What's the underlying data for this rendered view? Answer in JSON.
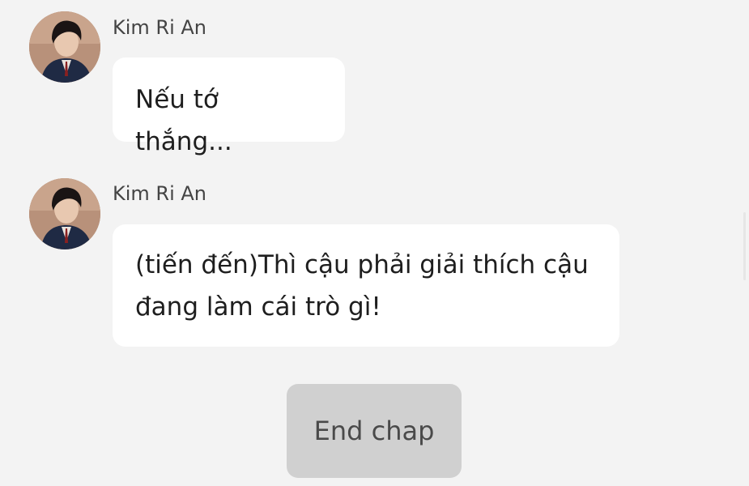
{
  "messages": [
    {
      "sender": "Kim Ri An",
      "avatar_icon": "profile-photo-avatar",
      "lines": [
        "Nếu tớ thắng..."
      ]
    },
    {
      "sender": "Kim Ri An",
      "avatar_icon": "profile-photo-avatar",
      "lines": [
        "(tiến đến)Thì cậu phải giải thích cậu",
        "đang làm cái trò gì!"
      ]
    }
  ],
  "end_button": {
    "label": "End chap"
  },
  "colors": {
    "background": "#f3f3f3",
    "bubble": "#ffffff",
    "button": "#d0d0d0",
    "text": "#1e1e1e"
  }
}
